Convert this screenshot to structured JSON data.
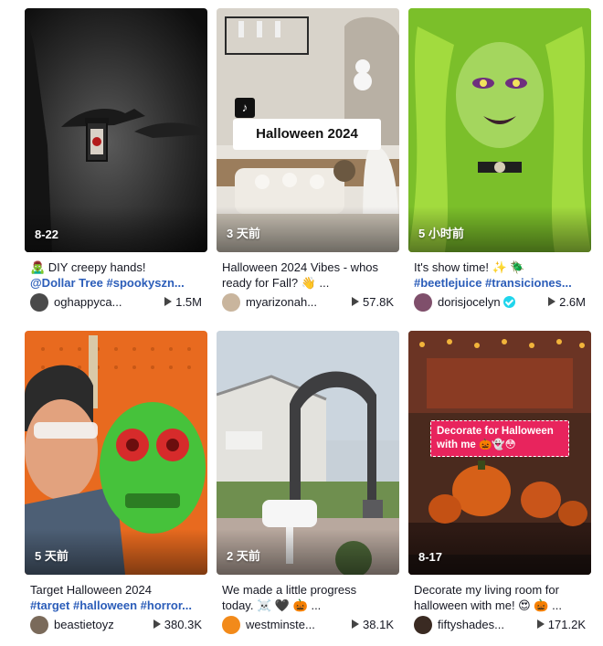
{
  "videos": [
    {
      "date": "8-22",
      "caption_text": "🧟‍♂️ DIY creepy hands!",
      "caption_hashtags": "@Dollar Tree #spookyszn...",
      "username": "oghappyca...",
      "views": "1.5M",
      "verified": false
    },
    {
      "date": "3 天前",
      "overlay_text": "Halloween 2024",
      "caption_line1": "Halloween 2024 Vibes - whos",
      "caption_line2": "ready for Fall? 👋 ...",
      "username": "myarizonah...",
      "views": "57.8K",
      "verified": false
    },
    {
      "date": "5 小时前",
      "caption_text": "It's show time! ✨ 🪲",
      "caption_hashtags": "#beetlejuice #transiciones...",
      "username": "dorisjocelyn",
      "views": "2.6M",
      "verified": true
    },
    {
      "date": "5 天前",
      "caption_text": "Target Halloween 2024",
      "caption_hashtags": "#target #halloween #horror...",
      "username": "beastietoyz",
      "views": "380.3K",
      "verified": false
    },
    {
      "date": "2 天前",
      "caption_line1": "We made a little progress",
      "caption_line2": "today. ☠️ 🖤 🎃 ...",
      "username": "westminste...",
      "views": "38.1K",
      "verified": false
    },
    {
      "date": "8-17",
      "overlay_text": "Decorate for Halloween with me 🎃👻😳",
      "caption_line1": "Decorate my living room for",
      "caption_line2": "halloween with me! 😍 🎃 ...",
      "username": "fiftyshades...",
      "views": "171.2K",
      "verified": false
    }
  ],
  "colors": {
    "hashtag": "#2b5db9",
    "verified_badge": "#20d5ec",
    "overlay_pink": "#e8245d"
  }
}
